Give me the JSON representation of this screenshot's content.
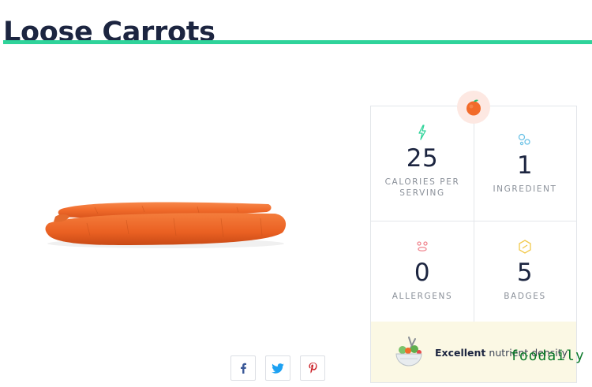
{
  "product": {
    "title": "Loose Carrots"
  },
  "share": {
    "facebook_icon": "facebook-icon",
    "twitter_icon": "twitter-icon",
    "pinterest_icon": "pinterest-icon"
  },
  "stats": {
    "calories": {
      "value": "25",
      "label": "CALORIES PER SERVING",
      "icon": "lightning-icon"
    },
    "ingredients": {
      "value": "1",
      "label": "INGREDIENT",
      "icon": "bubbles-icon"
    },
    "allergens": {
      "value": "0",
      "label": "ALLERGENS",
      "icon": "allergen-icon"
    },
    "badges": {
      "value": "5",
      "label": "BADGES",
      "icon": "hexagon-icon"
    }
  },
  "density": {
    "rating": "Excellent",
    "text": "nutrient density"
  },
  "watermark": "foodaily",
  "colors": {
    "accent": "#2fd39a",
    "carrot": "#f26b2a",
    "density_bg": "#fbf8e4"
  }
}
